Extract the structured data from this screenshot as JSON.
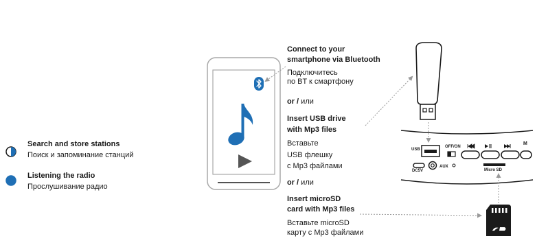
{
  "legend": {
    "item1": {
      "title": "Search and store stations",
      "subtitle": "Поиск и запоминание станций"
    },
    "item2": {
      "title": "Listening the radio",
      "subtitle": "Прослушивание радио"
    }
  },
  "steps": {
    "bt": {
      "title1": "Connect to your",
      "title2": "smartphone via Bluetooth",
      "ru1": "Подключитесь",
      "ru2": "по BT к смартфону"
    },
    "or1": {
      "en": "or /",
      "ru": " или"
    },
    "usb": {
      "title1": "Insert USB drive",
      "title2": "with Mp3 files",
      "ru1": "Вставьте",
      "ru2": "USB флешку",
      "ru3": "с Mp3 файлами"
    },
    "or2": {
      "en": "or /",
      "ru": " или"
    },
    "sd": {
      "title1": "Insert microSD",
      "title2": "card with Mp3 files",
      "ru1": "Вставьте microSD",
      "ru2": "карту с Mp3 файлами"
    }
  },
  "panel": {
    "usb": "USB",
    "offon": "OFF/ON",
    "m": "M",
    "dc5v": "DC5V",
    "aux": "AUX",
    "microsd": "Micro SD"
  },
  "colors": {
    "accent": "#1f6fb5",
    "dark": "#1a1a1a",
    "grey": "#999999"
  }
}
